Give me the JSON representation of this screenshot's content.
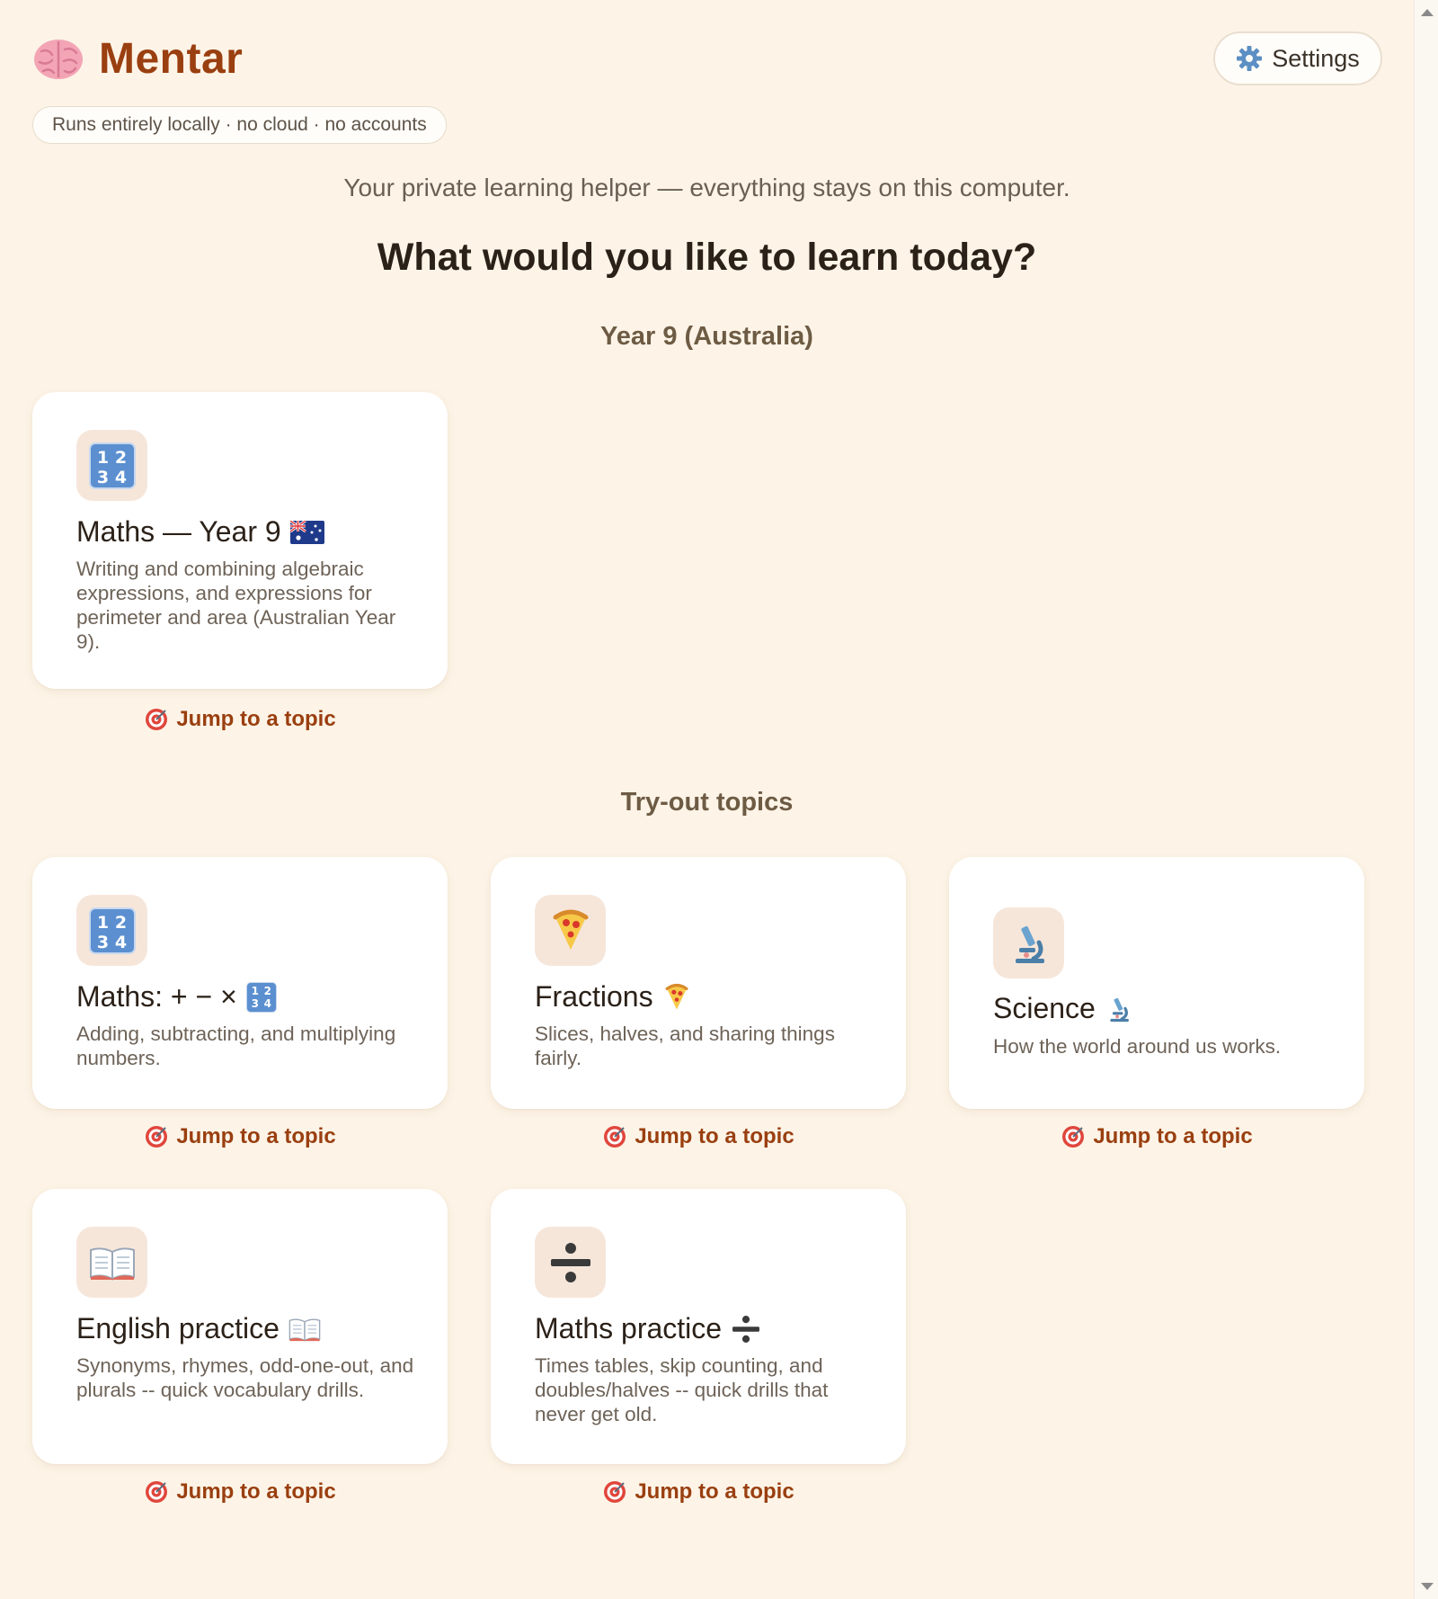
{
  "app": {
    "name": "Mentar",
    "settings_label": "Settings",
    "local_pill": "Runs entirely locally · no cloud · no accounts",
    "tagline": "Your private learning helper — everything stays on this computer.",
    "headline": "What would you like to learn today?"
  },
  "sections": {
    "curriculum_title": "Year 9 (Australia)",
    "tryout_title": "Try-out topics"
  },
  "curriculum_cards": [
    {
      "title": "Maths — Year 9",
      "title_icon": "australia-flag-icon",
      "icon": "numbers-icon",
      "description": "Writing and combining algebraic expressions, and expressions for perimeter and area (Australian Year 9).",
      "jump_label": "Jump to a topic"
    }
  ],
  "tryout_cards": [
    {
      "title": "Maths: + − ×",
      "title_icon": "numbers-icon",
      "icon": "numbers-icon",
      "description": "Adding, subtracting, and multiplying numbers.",
      "jump_label": "Jump to a topic"
    },
    {
      "title": "Fractions",
      "title_icon": "pizza-icon",
      "icon": "pizza-icon",
      "description": "Slices, halves, and sharing things fairly.",
      "jump_label": "Jump to a topic"
    },
    {
      "title": "Science",
      "title_icon": "microscope-icon",
      "icon": "microscope-icon",
      "description": "How the world around us works.",
      "jump_label": "Jump to a topic"
    },
    {
      "title": "English practice",
      "title_icon": "book-icon",
      "icon": "book-icon",
      "description": "Synonyms, rhymes, odd-one-out, and plurals -- quick vocabulary drills.",
      "jump_label": "Jump to a topic"
    },
    {
      "title": "Maths practice",
      "title_icon": "divide-icon",
      "icon": "divide-icon",
      "description": "Times tables, skip counting, and doubles/halves -- quick drills that never get old.",
      "jump_label": "Jump to a topic"
    }
  ],
  "colors": {
    "background": "#fdf4e7",
    "brand": "#9a3f10",
    "card": "#ffffff",
    "icon_tile": "#f6e6da",
    "section_title": "#6e5b44"
  }
}
